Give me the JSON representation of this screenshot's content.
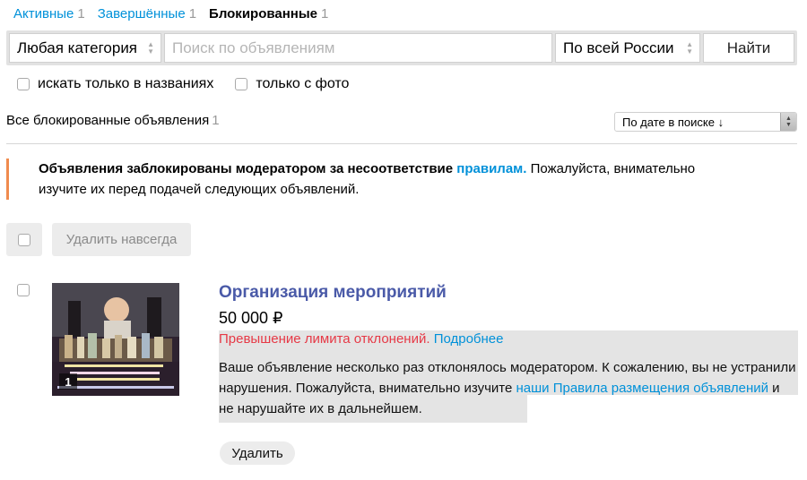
{
  "tabs": [
    {
      "label": "Активные",
      "count": "1"
    },
    {
      "label": "Завершённые",
      "count": "1"
    },
    {
      "label": "Блокированные",
      "count": "1"
    }
  ],
  "search": {
    "category": "Любая категория",
    "placeholder": "Поиск по объявлениям",
    "region": "По всей России",
    "button": "Найти"
  },
  "filters": {
    "titles_only": "искать только в названиях",
    "with_photo": "только с фото"
  },
  "list_header": {
    "label": "Все блокированные объявления",
    "count": "1",
    "sort": "По дате в поиске ↓"
  },
  "notice": {
    "bold_text": "Объявления заблокированы модератором за несоответствие",
    "link": "правилам.",
    "line1_rest": "Пожалуйста, внимательно",
    "line2": "изучите их перед подачей следующих объявлений."
  },
  "bulk": {
    "delete_forever": "Удалить навсегда"
  },
  "listing": {
    "photo_count": "1",
    "title": "Организация мероприятий",
    "price": "50 000 ₽",
    "reason": "Превышение лимита отклонений.",
    "reason_more": "Подробнее",
    "message_part1": "Ваше объявление несколько раз отклонялось модератором. К сожалению, вы не устранили нарушения. Пожалуйста, внимательно изучите",
    "message_link": "наши Правила размещения объявлений",
    "message_part2": "и не нарушайте их в дальнейшем.",
    "delete": "Удалить"
  },
  "colors": {
    "link": "#0091d9",
    "title": "#4a5aa8",
    "error": "#e63946",
    "notice_border": "#f08b4e"
  }
}
